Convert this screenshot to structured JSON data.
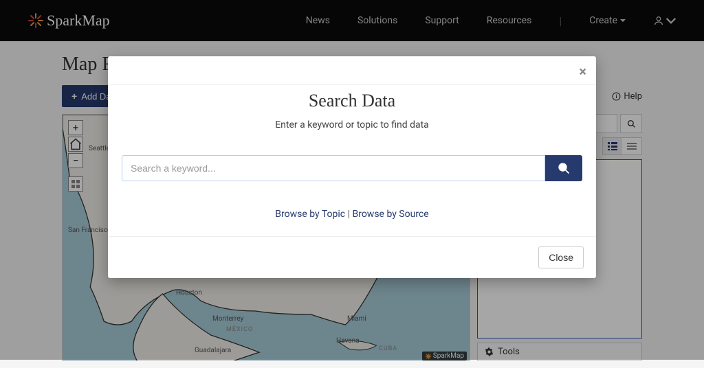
{
  "brand": "SparkMap",
  "nav": {
    "items": [
      "News",
      "Solutions",
      "Support",
      "Resources",
      "Create"
    ]
  },
  "page": {
    "title": "Map Room",
    "add_data_label": "Add Data",
    "help_label": "Help"
  },
  "side": {
    "tools_label": "Tools"
  },
  "map": {
    "attribution": "SparkMap",
    "cities": [
      "Seattle",
      "San Francisco",
      "Houston",
      "Monterrey",
      "MÉXICO",
      "Guadalajara",
      "Havana",
      "Miami",
      "CUBA"
    ]
  },
  "modal": {
    "title": "Search Data",
    "subtitle": "Enter a keyword or topic to find data",
    "placeholder": "Search a keyword...",
    "browse_topic": "Browse by Topic",
    "browse_source": "Browse by Source",
    "separator": " | ",
    "close_label": "Close"
  }
}
